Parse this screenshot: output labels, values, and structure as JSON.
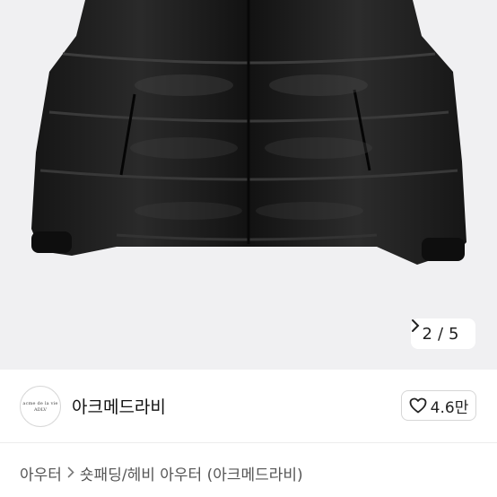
{
  "gallery": {
    "image_alt": "black puffer jacket",
    "pager": {
      "current": "2",
      "separator": "/",
      "total": "5",
      "next_icon": "chevron-right-icon"
    }
  },
  "shop": {
    "avatar_text_line1": "acme de la vie",
    "avatar_text_line2": "ADLV",
    "name": "아크메드라비",
    "like_icon": "heart-outline-icon",
    "like_count": "4.6만"
  },
  "breadcrumb": {
    "items": [
      "아우터",
      "숏패딩/헤비 아우터 (아크메드라비)"
    ],
    "separator_icon": "chevron-right-icon"
  }
}
